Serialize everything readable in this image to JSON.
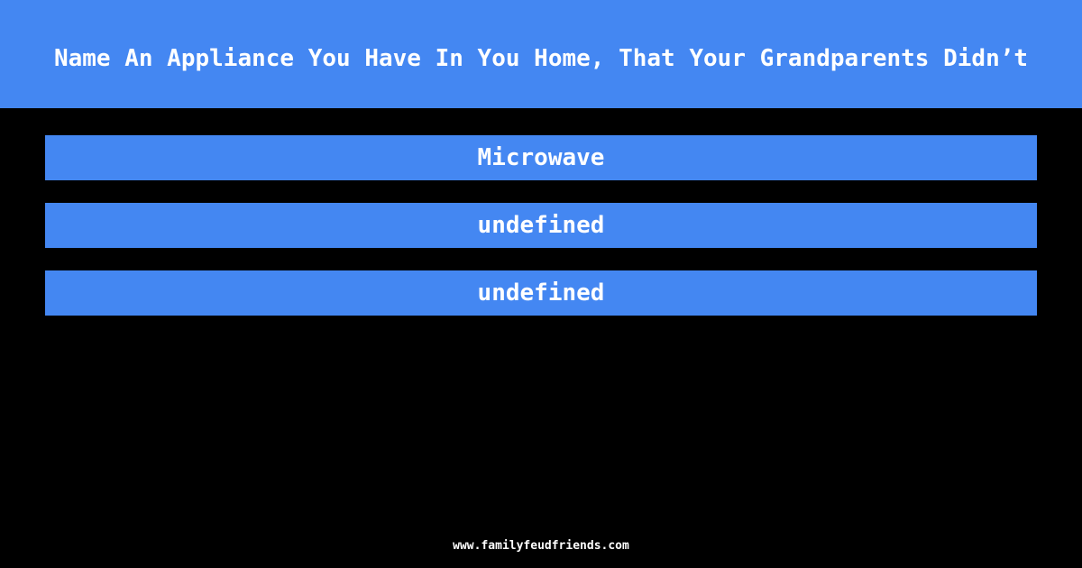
{
  "question": "Name An Appliance You Have In You Home, That Your Grandparents Didn’t",
  "answers": [
    {
      "text": "Microwave"
    },
    {
      "text": "undefined"
    },
    {
      "text": "undefined"
    }
  ],
  "footer": {
    "site": "www.familyfeudfriends.com"
  },
  "colors": {
    "accent": "#4487f2",
    "background": "#000000",
    "text": "#ffffff"
  }
}
